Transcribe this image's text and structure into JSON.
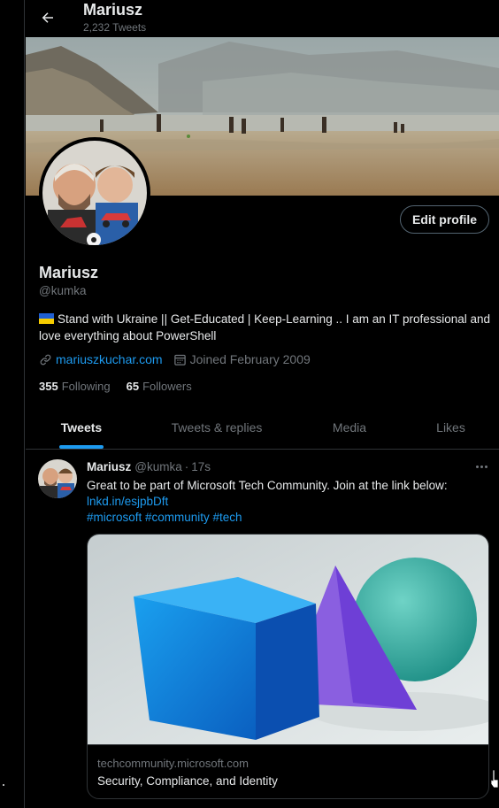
{
  "header": {
    "name": "Mariusz",
    "tweet_count": "2,232 Tweets"
  },
  "profile": {
    "edit_label": "Edit profile",
    "name": "Mariusz",
    "handle": "@kumka",
    "bio": "Stand with Ukraine || Get-Educated | Keep-Learning .. I am an IT professional and love everything about PowerShell",
    "website": "mariuszkuchar.com",
    "joined": "Joined February 2009",
    "following_count": "355",
    "following_label": "Following",
    "followers_count": "65",
    "followers_label": "Followers"
  },
  "tabs": [
    {
      "label": "Tweets",
      "active": true
    },
    {
      "label": "Tweets & replies",
      "active": false
    },
    {
      "label": "Media",
      "active": false
    },
    {
      "label": "Likes",
      "active": false
    }
  ],
  "tweet": {
    "author": "Mariusz",
    "handle": "@kumka",
    "separator": "·",
    "time": "17s",
    "text": "Great to be part of Microsoft Tech Community. Join at the link below:",
    "link": "lnkd.in/esjpbDft",
    "hashtags": "#microsoft #community #tech",
    "card": {
      "domain": "techcommunity.microsoft.com",
      "title": "Security, Compliance, and Identity"
    }
  },
  "colors": {
    "accent": "#1d9bf0",
    "text": "#e7e9ea",
    "muted": "#71767b",
    "border": "#2f3336"
  },
  "icons": [
    "back-arrow-icon",
    "link-icon",
    "calendar-icon",
    "more-icon",
    "flag-ukraine-icon"
  ]
}
